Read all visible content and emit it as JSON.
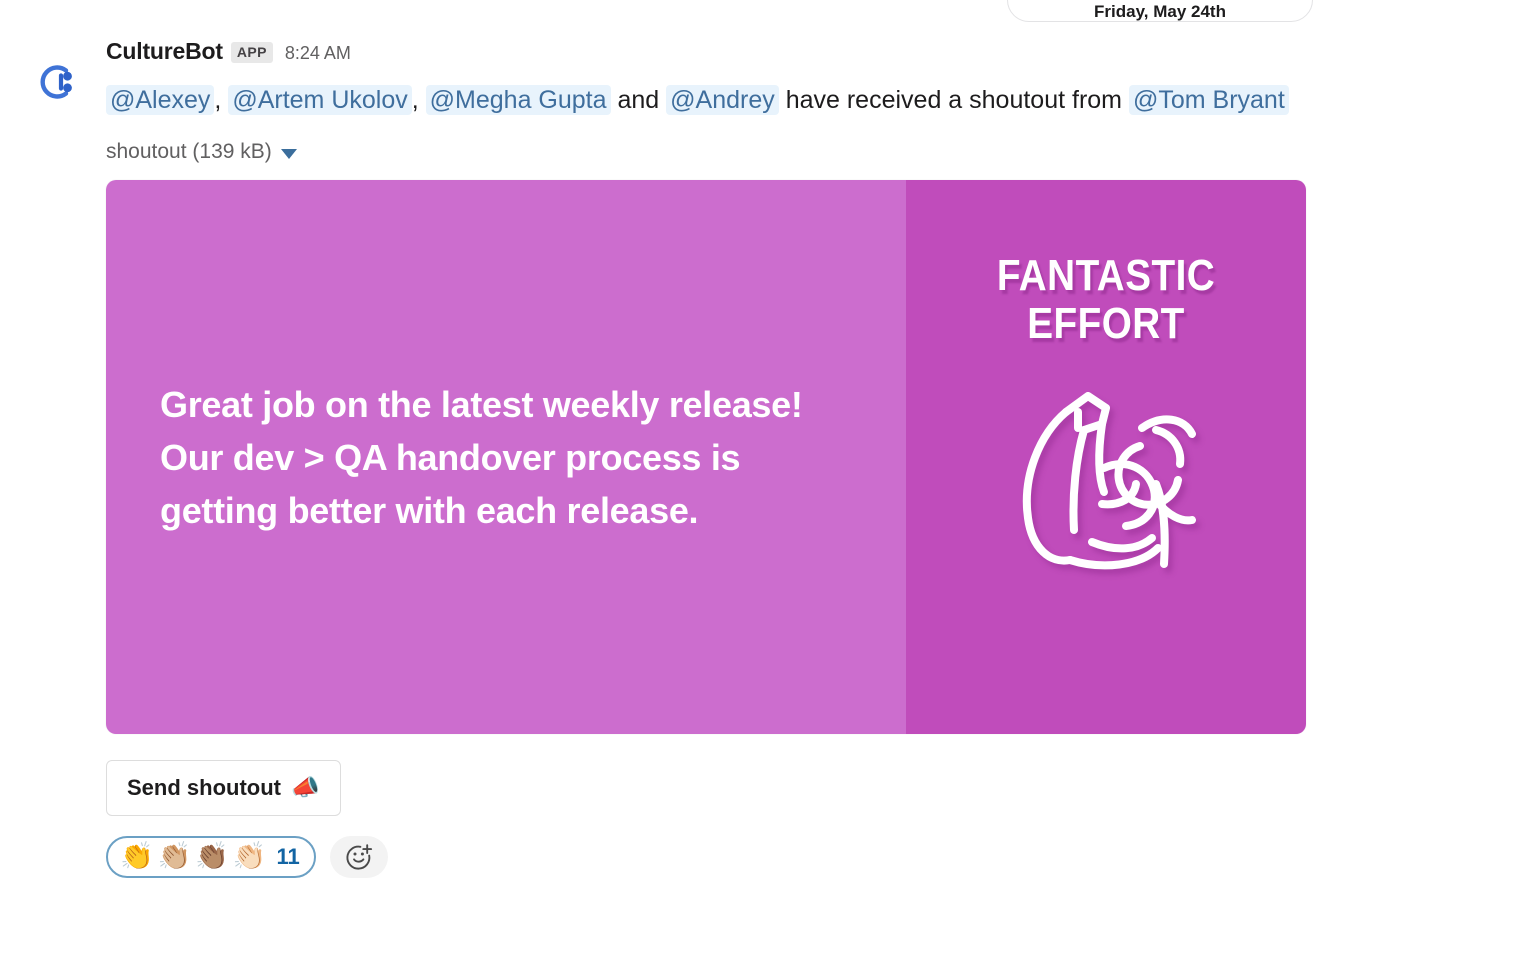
{
  "divider": {
    "label": "Friday, May 24th"
  },
  "message": {
    "sender": "CultureBot",
    "app_badge": "APP",
    "timestamp": "8:24 AM",
    "avatar_icon": "culturebot-logo",
    "text_parts": {
      "m1": "@Alexey",
      "sep1": ",",
      "m2": "@Artem Ukolov",
      "sep2": ",",
      "m3": "@Megha Gupta",
      "and": "and",
      "m4": "@Andrey",
      "middle": "have received a shoutout from",
      "m5": "@Tom Bryant"
    }
  },
  "attachment": {
    "name": "shoutout",
    "size": "(139 kB)",
    "label": "shoutout (139 kB)",
    "caret_icon": "chevron-down-icon"
  },
  "card": {
    "message": "Great job on the latest weekly release! Our dev > QA handover process is getting better with each release.",
    "title": "FANTASTIC EFFORT",
    "art_icon": "flexed-bicep-icon",
    "colors": {
      "left": "#cc6dce",
      "right": "#c04cbb",
      "text": "#ffffff"
    }
  },
  "actions": {
    "send_label": "Send shoutout",
    "send_emoji": "📣",
    "send_emoji_name": "megaphone-icon"
  },
  "reactions": {
    "emojis": [
      "👏",
      "👏🏼",
      "👏🏽",
      "👏🏻"
    ],
    "count": "11",
    "add_icon": "add-reaction-icon"
  }
}
